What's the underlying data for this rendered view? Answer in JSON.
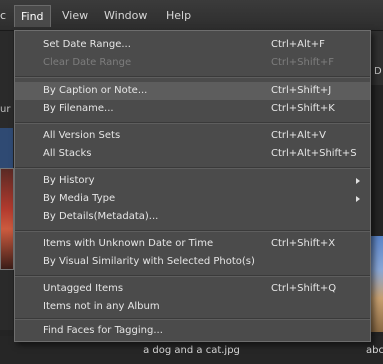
{
  "menubar": {
    "left_edge": "c",
    "find": "Find",
    "view": "View",
    "window": "Window",
    "help": "Help"
  },
  "background": {
    "right_header_letter": "D",
    "left_text": "ur",
    "caption": "a dog and a cat.jpg",
    "right_caption": "abc"
  },
  "find_menu": {
    "set_date_range": {
      "label": "Set Date Range...",
      "shortcut": "Ctrl+Alt+F"
    },
    "clear_date_range": {
      "label": "Clear Date Range",
      "shortcut": "Ctrl+Shift+F"
    },
    "by_caption": {
      "label": "By Caption or Note...",
      "shortcut": "Ctrl+Shift+J"
    },
    "by_filename": {
      "label": "By Filename...",
      "shortcut": "Ctrl+Shift+K"
    },
    "all_version_sets": {
      "label": "All Version Sets",
      "shortcut": "Ctrl+Alt+V"
    },
    "all_stacks": {
      "label": "All Stacks",
      "shortcut": "Ctrl+Alt+Shift+S"
    },
    "by_history": {
      "label": "By History"
    },
    "by_media_type": {
      "label": "By Media Type"
    },
    "by_details": {
      "label": "By Details(Metadata)..."
    },
    "unknown_date": {
      "label": "Items with Unknown Date or Time",
      "shortcut": "Ctrl+Shift+X"
    },
    "visual_similarity": {
      "label": "By Visual Similarity with Selected Photo(s)"
    },
    "untagged": {
      "label": "Untagged Items",
      "shortcut": "Ctrl+Shift+Q"
    },
    "not_in_album": {
      "label": "Items not in any Album"
    },
    "find_faces": {
      "label": "Find Faces for Tagging..."
    }
  }
}
